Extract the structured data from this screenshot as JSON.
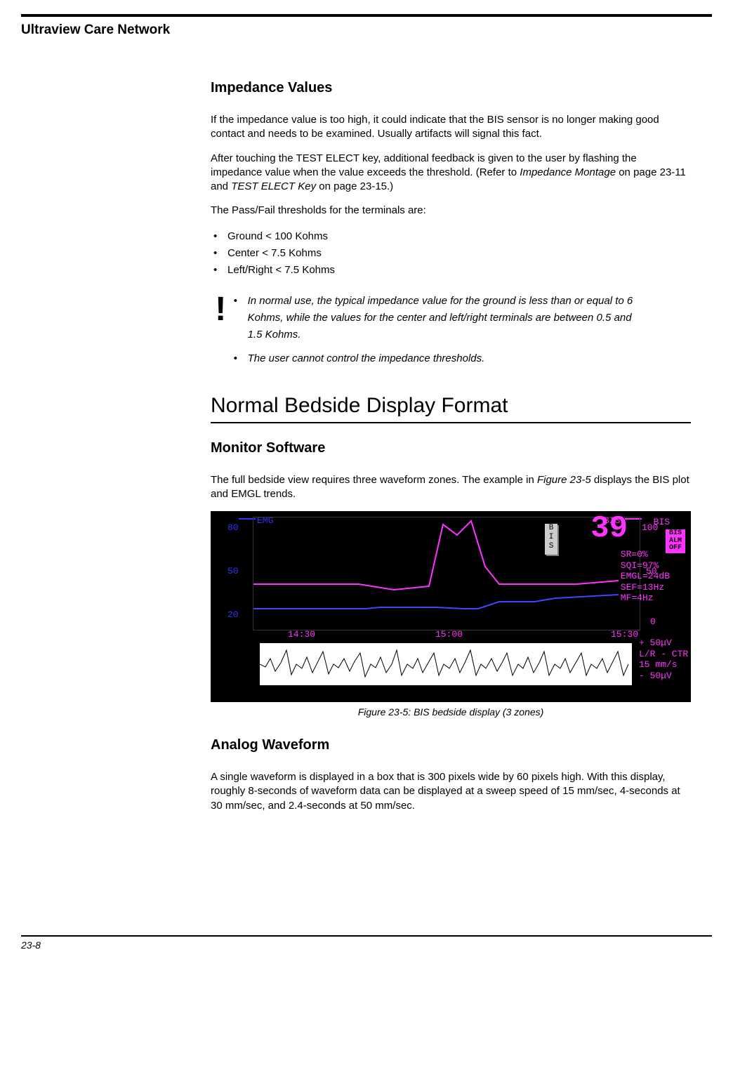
{
  "header_title": "Ultraview Care Network",
  "section1": {
    "heading": "Impedance Values",
    "p1": "If the impedance value is too high, it could indicate that the BIS sensor is no longer making good contact and needs to be examined. Usually artifacts will signal this fact.",
    "p2_a": "After touching the TEST ELECT key, additional feedback is given to the user by flashing the impedance value when the value exceeds the threshold. (Refer to ",
    "p2_em1": "Impedance Montage",
    "p2_mid": " on page 23-11 and ",
    "p2_em2": "TEST ELECT Key",
    "p2_end": " on page 23-15.)",
    "p3": "The Pass/Fail thresholds for the terminals are:",
    "thresholds": [
      "Ground < 100 Kohms",
      "Center < 7.5 Kohms",
      "Left/Right < 7.5 Kohms"
    ],
    "note_icon": "!",
    "notes": [
      "In normal use, the typical impedance value for the ground is less than or equal to 6 Kohms, while the values for the center and left/right terminals are between 0.5 and 1.5 Kohms.",
      "The user cannot control the impedance thresholds."
    ]
  },
  "section2": {
    "heading": "Normal Bedside Display Format",
    "sub1_heading": "Monitor Software",
    "sub1_p_a": "The full bedside view requires three waveform zones. The example in ",
    "sub1_p_em": "Figure 23-5",
    "sub1_p_b": " displays the BIS plot and EMGL trends.",
    "fig_caption": "Figure 23-5: BIS bedside display (3 zones)",
    "sub2_heading": "Analog Waveform",
    "sub2_p": "A single waveform is displayed in a box that is 300 pixels wide by 60 pixels high. With this display, roughly 8-seconds of waveform data can be displayed at a sweep speed of 15 mm/sec, 4-seconds at 30 mm/sec, and 2.4-seconds at 50 mm/sec."
  },
  "figure": {
    "emg_label": "EMG",
    "bis_label": "BIS",
    "y_left": [
      "80",
      "50",
      "20"
    ],
    "y_right": [
      "100",
      "50",
      "0"
    ],
    "x_ticks": [
      "14:30",
      "15:00",
      "15:30"
    ],
    "big_value": "39",
    "bis_small": "BIS",
    "stats": [
      "SR=0%",
      "SQI=97%",
      "EMGL=24dB",
      "SEF=13Hz",
      "MF=4Hz"
    ],
    "bis_tab": "B\nI\nS",
    "alm_badge": "BIS\nALM\nOFF",
    "wave_info": [
      "+ 50μV",
      "L/R - CTR",
      "15 mm/s",
      "- 50μV"
    ]
  },
  "page_number": "23-8",
  "chart_data": {
    "type": "line",
    "title": "BIS bedside display (3 zones)",
    "x_ticks": [
      "14:30",
      "15:00",
      "15:30"
    ],
    "series": [
      {
        "name": "EMG",
        "axis": "left",
        "ylim": [
          0,
          100
        ],
        "y_ticks": [
          20,
          50,
          80
        ],
        "approx_values": [
          20,
          20,
          22,
          22,
          20,
          20,
          26,
          26,
          28,
          30
        ]
      },
      {
        "name": "BIS",
        "axis": "right",
        "ylim": [
          0,
          100
        ],
        "y_ticks": [
          0,
          50,
          100
        ],
        "approx_values": [
          40,
          40,
          35,
          38,
          95,
          85,
          98,
          55,
          40,
          40,
          40,
          45
        ]
      }
    ],
    "readouts": {
      "BIS_current": 39,
      "SR_percent": 0,
      "SQI_percent": 97,
      "EMGL_dB": 24,
      "SEF_Hz": 13,
      "MF_Hz": 4,
      "sweep_mm_per_s": 15,
      "scale_uV": 50,
      "channel": "L/R - CTR",
      "alarm": "BIS ALM OFF"
    }
  }
}
